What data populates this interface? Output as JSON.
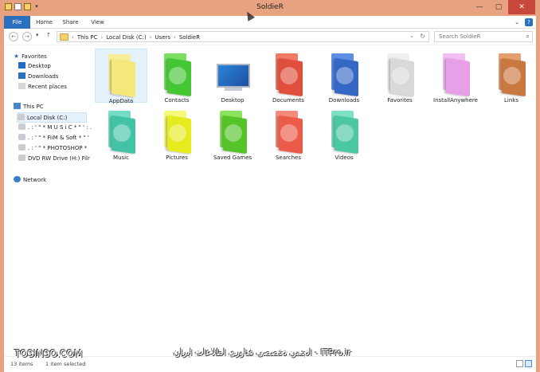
{
  "window": {
    "title": "SoldieR"
  },
  "ribbon": {
    "tabs": [
      {
        "label": "File"
      },
      {
        "label": "Home"
      },
      {
        "label": "Share"
      },
      {
        "label": "View"
      }
    ]
  },
  "navigation": {
    "crumbs": [
      "This PC",
      "Local Disk (C:)",
      "Users",
      "SoldieR"
    ],
    "search_placeholder": "Search SoldieR"
  },
  "sidebar": {
    "items": [
      {
        "label": "Favorites"
      },
      {
        "label": "Desktop"
      },
      {
        "label": "Downloads"
      },
      {
        "label": "Recent places"
      },
      {
        "label": "This PC"
      },
      {
        "label": "Local Disk (C:)"
      },
      {
        "label": ". : ' \" * M U S i C * \" ' : ."
      },
      {
        "label": ". : ' \" * FiiM & Soft * \" '"
      },
      {
        "label": ". : ' \" * PHOTOSHOP *"
      },
      {
        "label": "DVD RW Drive (H:) Filr"
      },
      {
        "label": "Network"
      }
    ]
  },
  "files": {
    "items": [
      {
        "label": "AppData",
        "color": "#f6e77a",
        "overlay": "folder",
        "selected": true
      },
      {
        "label": "Contacts",
        "color": "#45c735",
        "overlay": "contacts",
        "selected": false
      },
      {
        "label": "Desktop",
        "color": "#2b70c8",
        "overlay": "desktop",
        "selected": false
      },
      {
        "label": "Documents",
        "color": "#df4f3b",
        "overlay": "documents",
        "selected": false
      },
      {
        "label": "Downloads",
        "color": "#3568c4",
        "overlay": "downloads",
        "selected": false
      },
      {
        "label": "Favorites",
        "color": "#d9d9d9",
        "overlay": "star",
        "selected": false
      },
      {
        "label": "InstallAnywhere",
        "color": "#e7a0e8",
        "overlay": "folder",
        "selected": false
      },
      {
        "label": "Links",
        "color": "#c9783f",
        "overlay": "links",
        "selected": false
      },
      {
        "label": "Music",
        "color": "#42c3a6",
        "overlay": "music",
        "selected": false
      },
      {
        "label": "Pictures",
        "color": "#e6eb1e",
        "overlay": "pictures",
        "selected": false
      },
      {
        "label": "Saved Games",
        "color": "#55c428",
        "overlay": "games",
        "selected": false
      },
      {
        "label": "Searches",
        "color": "#ec5a49",
        "overlay": "search",
        "selected": false
      },
      {
        "label": "Videos",
        "color": "#4cc7a3",
        "overlay": "videos",
        "selected": false
      }
    ]
  },
  "status": {
    "count": "13 items",
    "selected": "1 item selected"
  },
  "watermarks": {
    "left": "TOSINSO.COM",
    "right": "انجمن تخصصی فناوری اطلاعات ایران - ITPro.ir"
  }
}
